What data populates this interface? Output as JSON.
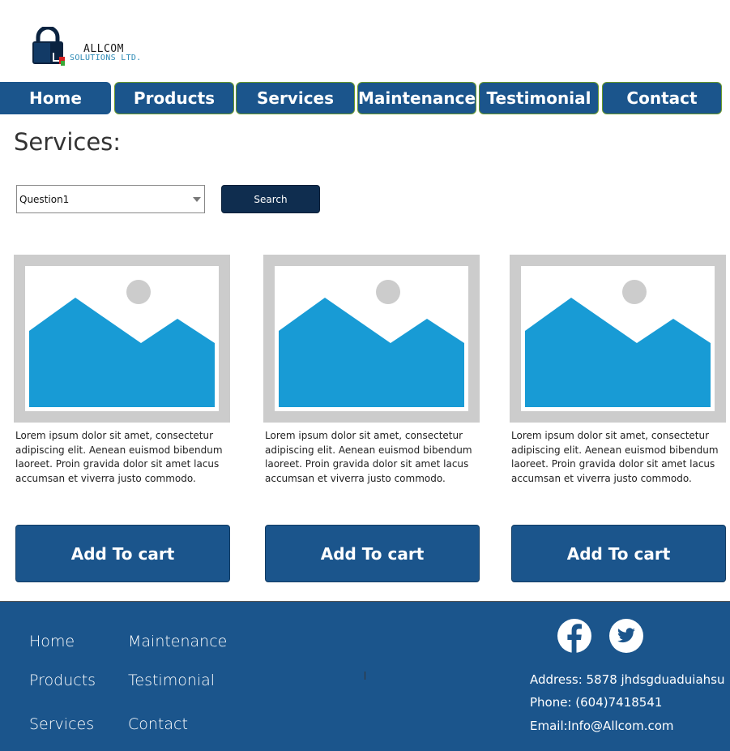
{
  "logo": {
    "name": "ALLCOM",
    "subtitle": "SOLUTIONS LTD."
  },
  "nav": [
    {
      "label": "Home"
    },
    {
      "label": "Products"
    },
    {
      "label": "Services"
    },
    {
      "label": "Maintenance"
    },
    {
      "label": "Testimonial"
    },
    {
      "label": "Contact"
    }
  ],
  "page": {
    "title": "Services:"
  },
  "search": {
    "selected": "Question1",
    "button_label": "Search"
  },
  "cards": [
    {
      "text": "Lorem ipsum dolor sit amet, consectetur adipiscing elit. Aenean euismod bibendum laoreet. Proin gravida dolor sit amet lacus accumsan et viverra justo commodo.",
      "button_label": "Add To cart"
    },
    {
      "text": "Lorem ipsum dolor sit amet, consectetur adipiscing elit. Aenean euismod bibendum laoreet. Proin gravida dolor sit amet lacus accumsan et viverra justo commodo.",
      "button_label": "Add To cart"
    },
    {
      "text": "Lorem ipsum dolor sit amet, consectetur adipiscing elit. Aenean euismod bibendum laoreet. Proin gravida dolor sit amet lacus accumsan et viverra justo commodo.",
      "button_label": "Add To cart"
    }
  ],
  "footer": {
    "links": [
      {
        "label": "Home"
      },
      {
        "label": "Maintenance"
      },
      {
        "label": "Products"
      },
      {
        "label": "Testimonial"
      },
      {
        "label": "Services"
      },
      {
        "label": "Contact"
      }
    ],
    "address": "Address: 5878 jhdsgduaduiahsu",
    "phone": "Phone: (604)7418541",
    "email": "Email:Info@Allcom.com",
    "social": [
      "facebook-icon",
      "twitter-icon"
    ]
  },
  "colors": {
    "primary": "#1b558c",
    "search_button": "#0f2d4f",
    "image_frame": "#cccccc",
    "image_blue": "#189bd5",
    "nav_border": "#6b9a2a"
  }
}
